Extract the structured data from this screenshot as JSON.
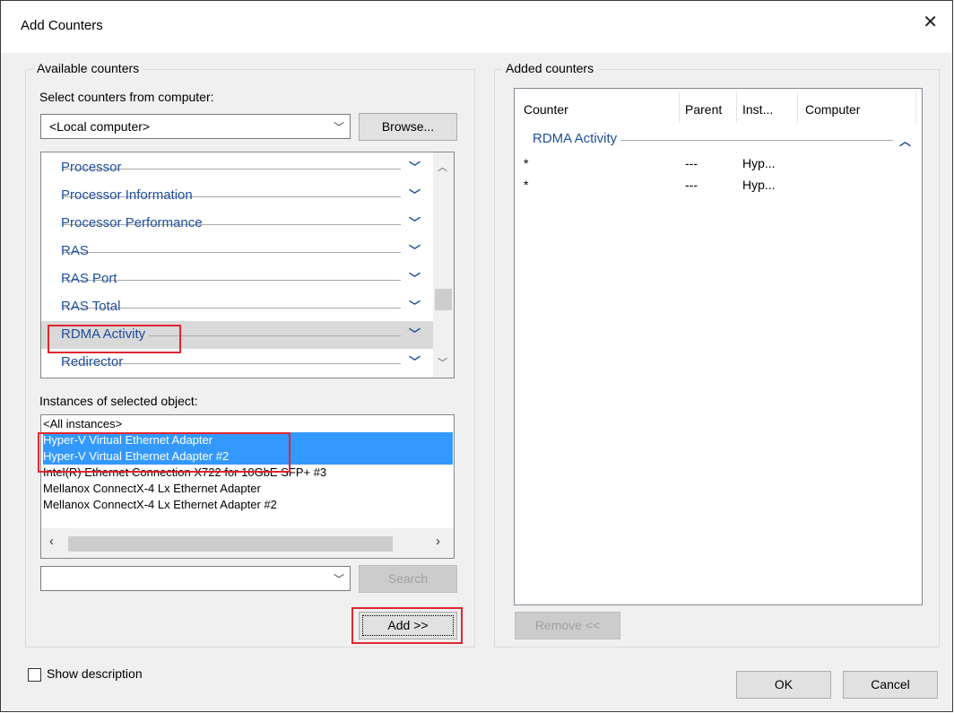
{
  "window": {
    "title": "Add Counters",
    "close_icon": "close-icon"
  },
  "available": {
    "group_label": "Available counters",
    "select_label": "Select counters from computer:",
    "computer_value": "<Local computer>",
    "browse_label": "Browse...",
    "objects": [
      {
        "name": "Processor",
        "selected": false
      },
      {
        "name": "Processor Information",
        "selected": false
      },
      {
        "name": "Processor Performance",
        "selected": false
      },
      {
        "name": "RAS",
        "selected": false
      },
      {
        "name": "RAS Port",
        "selected": false
      },
      {
        "name": "RAS Total",
        "selected": false
      },
      {
        "name": "RDMA Activity",
        "selected": true
      },
      {
        "name": "Redirector",
        "selected": false
      }
    ],
    "instances_label": "Instances of selected object:",
    "instances": [
      {
        "name": "<All instances>",
        "selected": false
      },
      {
        "name": "Hyper-V Virtual Ethernet Adapter",
        "selected": true
      },
      {
        "name": "Hyper-V Virtual Ethernet Adapter #2",
        "selected": true
      },
      {
        "name": "Intel(R) Ethernet Connection X722 for 10GbE SFP+ #3",
        "selected": false
      },
      {
        "name": "Mellanox ConnectX-4 Lx Ethernet Adapter",
        "selected": false
      },
      {
        "name": "Mellanox ConnectX-4 Lx Ethernet Adapter #2",
        "selected": false
      }
    ],
    "search_value": "",
    "search_label": "Search",
    "add_label": "Add >>"
  },
  "added": {
    "group_label": "Added counters",
    "columns": [
      "Counter",
      "Parent",
      "Inst...",
      "Computer"
    ],
    "group_name": "RDMA Activity",
    "rows": [
      {
        "counter": "*",
        "parent": "---",
        "instance": "Hyp...",
        "computer": ""
      },
      {
        "counter": "*",
        "parent": "---",
        "instance": "Hyp...",
        "computer": ""
      }
    ],
    "remove_label": "Remove <<"
  },
  "footer": {
    "show_description_label": "Show description",
    "show_description_checked": false,
    "ok_label": "OK",
    "cancel_label": "Cancel"
  },
  "colors": {
    "selection": "#3399ff",
    "link_blue": "#1f4e9c",
    "highlight_red": "#e0262f"
  }
}
